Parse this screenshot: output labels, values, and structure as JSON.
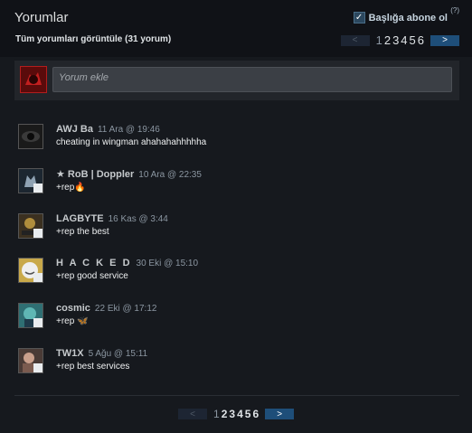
{
  "header": {
    "title": "Yorumlar",
    "subscribe_label": "Başlığa abone ol",
    "help": "(?)",
    "view_all": "Tüm yorumları görüntüle (31 yorum)"
  },
  "pagination": {
    "prev": "<",
    "next": ">",
    "pages": [
      "1",
      "2",
      "3",
      "4",
      "5",
      "6"
    ],
    "current": "1"
  },
  "compose": {
    "placeholder": "Yorum ekle"
  },
  "comments": [
    {
      "author": "AWJ Ba",
      "time": "11 Ara @ 19:46",
      "text": "cheating in wingman ahahahahhhhha",
      "emoji": ""
    },
    {
      "author": "★ RoB | Doppler",
      "time": "10 Ara @ 22:35",
      "text": "+rep",
      "emoji": "🔥"
    },
    {
      "author": "LAGBYTE",
      "time": "16 Kas @ 3:44",
      "text": "+rep the best",
      "emoji": ""
    },
    {
      "author": "H A C K E D",
      "time": "30 Eki @ 15:10",
      "text": "+rep good service",
      "emoji": ""
    },
    {
      "author": "cosmic",
      "time": "22 Eki @ 17:12",
      "text": "+rep",
      "emoji": "🦋"
    },
    {
      "author": "TW1X",
      "time": "5 Ağu @ 15:11",
      "text": "+rep best services",
      "emoji": ""
    }
  ],
  "colors": {
    "background": "#16191e",
    "header_bg": "#101217",
    "accent": "#1e4e79"
  }
}
